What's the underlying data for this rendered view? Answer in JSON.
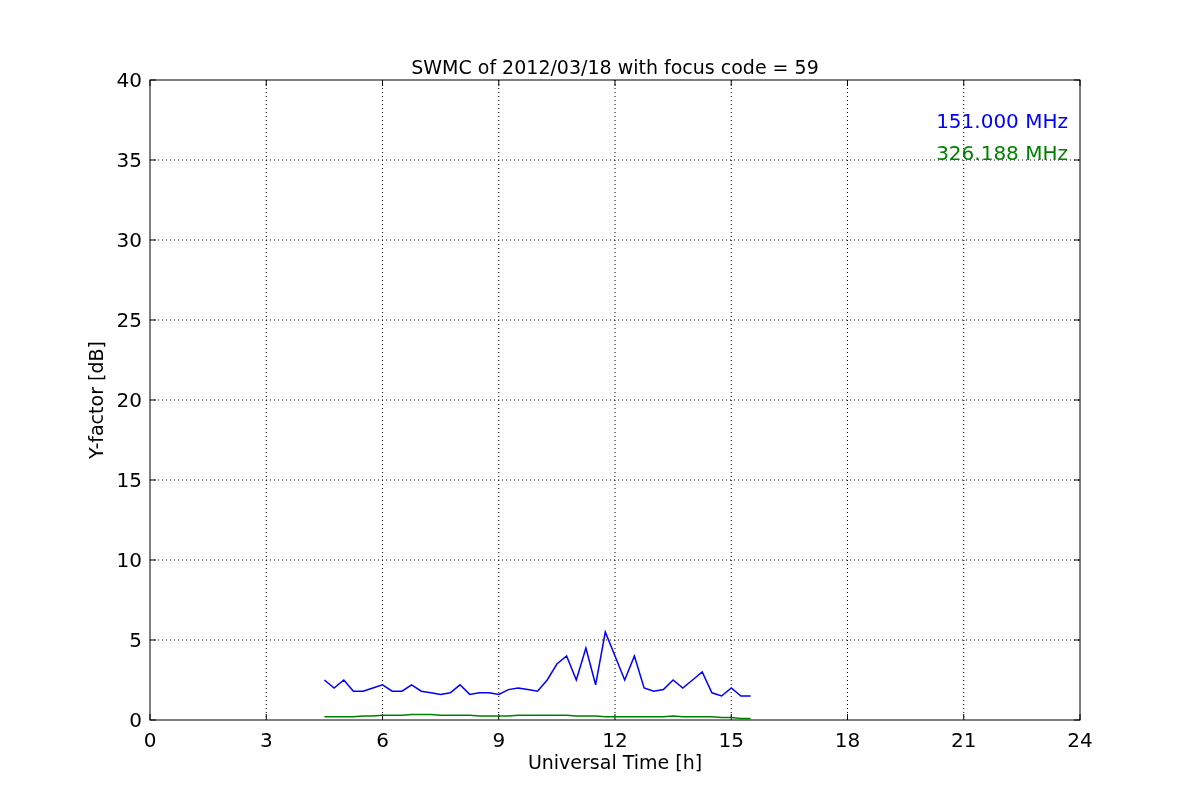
{
  "chart_data": {
    "type": "line",
    "title": "SWMC of 2012/03/18 with focus code = 59",
    "xlabel": "Universal Time [h]",
    "ylabel": "Y-factor [dB]",
    "x": [
      4.5,
      4.75,
      5,
      5.25,
      5.5,
      5.75,
      6,
      6.25,
      6.5,
      6.75,
      7,
      7.25,
      7.5,
      7.75,
      8,
      8.25,
      8.5,
      8.75,
      9,
      9.25,
      9.5,
      9.75,
      10,
      10.25,
      10.5,
      10.75,
      11,
      11.25,
      11.5,
      11.75,
      12,
      12.25,
      12.5,
      12.75,
      13,
      13.25,
      13.5,
      13.75,
      14,
      14.25,
      14.5,
      14.75,
      15,
      15.25,
      15.5
    ],
    "series": [
      {
        "name": "151.000 MHz",
        "color": "#0000ff",
        "values": [
          2.5,
          2.0,
          2.5,
          1.8,
          1.8,
          2.0,
          2.2,
          1.8,
          1.8,
          2.2,
          1.8,
          1.7,
          1.6,
          1.7,
          2.2,
          1.6,
          1.7,
          1.7,
          1.6,
          1.9,
          2.0,
          1.9,
          1.8,
          2.5,
          3.5,
          4.0,
          2.5,
          4.5,
          2.2,
          5.5,
          4.0,
          2.5,
          4.0,
          2.0,
          1.8,
          1.9,
          2.5,
          2.0,
          2.5,
          3.0,
          1.7,
          1.5,
          2.0,
          1.5,
          1.5
        ]
      },
      {
        "name": "326.188 MHz",
        "color": "#008000",
        "values": [
          0.2,
          0.2,
          0.2,
          0.2,
          0.25,
          0.25,
          0.3,
          0.3,
          0.3,
          0.35,
          0.35,
          0.35,
          0.3,
          0.3,
          0.3,
          0.3,
          0.25,
          0.25,
          0.25,
          0.25,
          0.3,
          0.3,
          0.3,
          0.3,
          0.3,
          0.3,
          0.25,
          0.25,
          0.25,
          0.2,
          0.2,
          0.2,
          0.2,
          0.2,
          0.2,
          0.2,
          0.25,
          0.2,
          0.2,
          0.2,
          0.2,
          0.15,
          0.15,
          0.1,
          0.1
        ]
      }
    ],
    "grid": true,
    "xlim": [
      0,
      24
    ],
    "ylim": [
      0,
      40
    ],
    "xticks": [
      0,
      3,
      6,
      9,
      12,
      15,
      18,
      21,
      24
    ],
    "yticks": [
      0,
      5,
      10,
      15,
      20,
      25,
      30,
      35,
      40
    ]
  }
}
